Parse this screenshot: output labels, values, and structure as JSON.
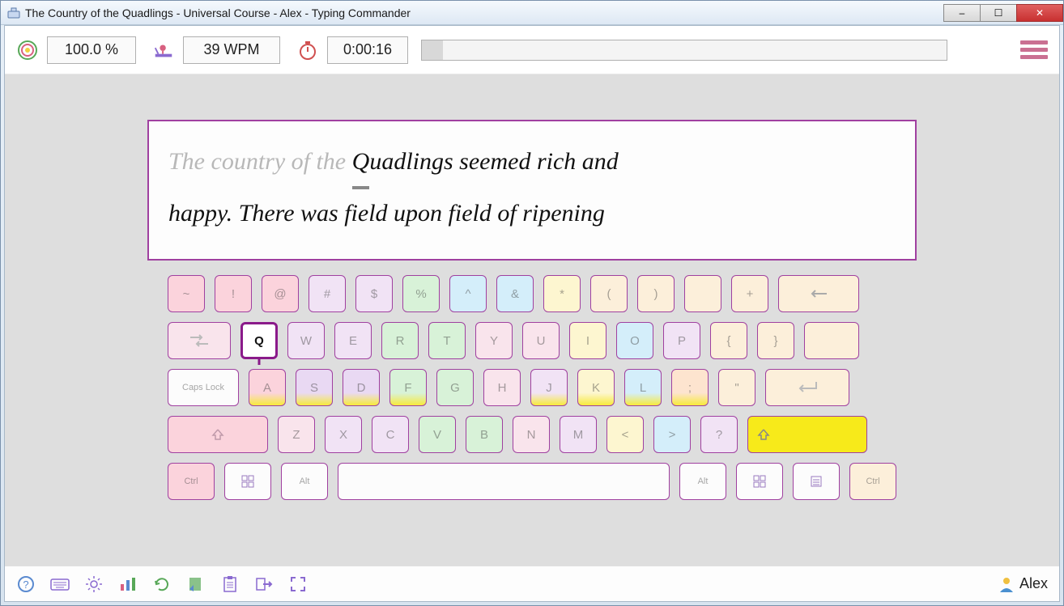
{
  "window": {
    "title": "The Country of the Quadlings - Universal Course - Alex - Typing Commander"
  },
  "stats": {
    "accuracy": "100.0 %",
    "speed": "39 WPM",
    "time": "0:00:16"
  },
  "text": {
    "typed": "The country of the ",
    "current_char": "Q",
    "remaining_line1": "uadlings seemed rich and",
    "line2": "happy. There was field upon field of ripening"
  },
  "keyboard": {
    "row1": [
      "~",
      "!",
      "@",
      "#",
      "$",
      "%",
      "^",
      "&",
      "*",
      "(",
      ")",
      "",
      "+"
    ],
    "row2": [
      "Q",
      "W",
      "E",
      "R",
      "T",
      "Y",
      "U",
      "I",
      "O",
      "P",
      "{",
      "}"
    ],
    "row3_caps": "Caps Lock",
    "row3": [
      "A",
      "S",
      "D",
      "F",
      "G",
      "H",
      "J",
      "K",
      "L",
      ";",
      "\""
    ],
    "row4": [
      "Z",
      "X",
      "C",
      "V",
      "B",
      "N",
      "M",
      "<",
      ">",
      "?"
    ],
    "row5": {
      "ctrl": "Ctrl",
      "alt": "Alt"
    },
    "highlighted_key": "Q",
    "shift_highlighted": true
  },
  "user": {
    "name": "Alex"
  },
  "toolbar_icons": [
    "help",
    "keyboard-layout",
    "settings",
    "statistics",
    "restart",
    "lesson-plan",
    "clipboard",
    "export",
    "fullscreen"
  ]
}
